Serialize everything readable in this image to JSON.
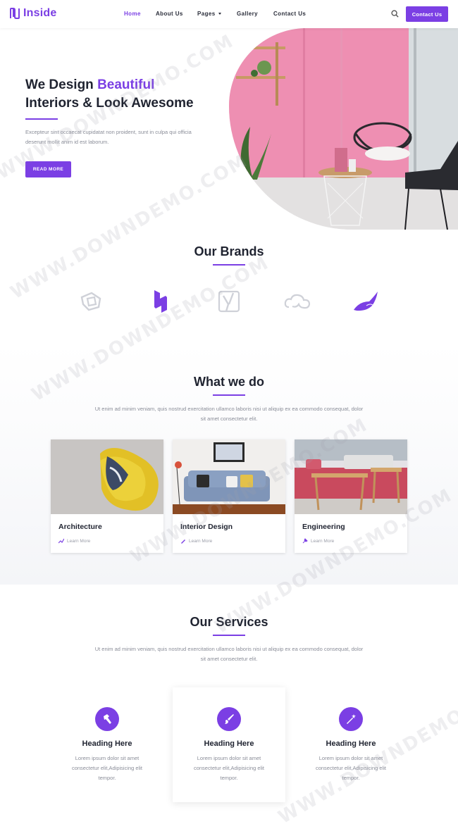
{
  "header": {
    "logo_text": "Inside",
    "nav": [
      {
        "label": "Home",
        "active": true
      },
      {
        "label": "About Us",
        "active": false
      },
      {
        "label": "Pages",
        "active": false,
        "dropdown": true
      },
      {
        "label": "Gallery",
        "active": false
      },
      {
        "label": "Contact Us",
        "active": false
      }
    ],
    "search_icon": "search-icon",
    "contact_button": "Contact Us"
  },
  "hero": {
    "title_part1": "We Design ",
    "title_accent": "Beautiful",
    "title_part2": "Interiors & Look Awesome",
    "description": "Excepteur sint occaecat cupidatat non proident, sunt in culpa qui officia deserunt mollit anim id est laborum.",
    "button": "READ MORE"
  },
  "brands": {
    "title": "Our Brands",
    "logos": [
      "brand-outline-logo",
      "brand-hexagon-logo",
      "brand-y-logo",
      "brand-cloud-logo",
      "brand-leaf-logo"
    ]
  },
  "what_we_do": {
    "title": "What we do",
    "description": "Ut enim ad minim veniam, quis nostrud exercitation ullamco laboris nisi ut aliquip ex ea commodo consequat, dolor sit amet consectetur elit.",
    "cards": [
      {
        "title": "Architecture",
        "link": "Learn More",
        "icon": "chart-icon"
      },
      {
        "title": "Interior Design",
        "link": "Learn More",
        "icon": "brush-icon"
      },
      {
        "title": "Engineering",
        "link": "Learn More",
        "icon": "tools-icon"
      }
    ]
  },
  "services": {
    "title": "Our Services",
    "description": "Ut enim ad minim veniam, quis nostrud exercitation ullamco laboris nisi ut aliquip ex ea commodo consequat, dolor sit amet consectetur elit.",
    "items": [
      {
        "title": "Heading Here",
        "text": "Lorem ipsum dolor sit amet consectetur elit,Adipisicing elit tempor.",
        "icon": "hammer-icon"
      },
      {
        "title": "Heading Here",
        "text": "Lorem ipsum dolor sit amet consectetur elit,Adipisicing elit tempor.",
        "icon": "paintbrush-icon"
      },
      {
        "title": "Heading Here",
        "text": "Lorem ipsum dolor sit amet consectetur elit,Adipisicing elit tempor.",
        "icon": "magic-wand-icon"
      }
    ]
  },
  "watermark": "WWW.DOWNDEMO.COM",
  "colors": {
    "accent": "#7b3fe4",
    "text": "#1f2330",
    "muted": "#8a8d98"
  }
}
